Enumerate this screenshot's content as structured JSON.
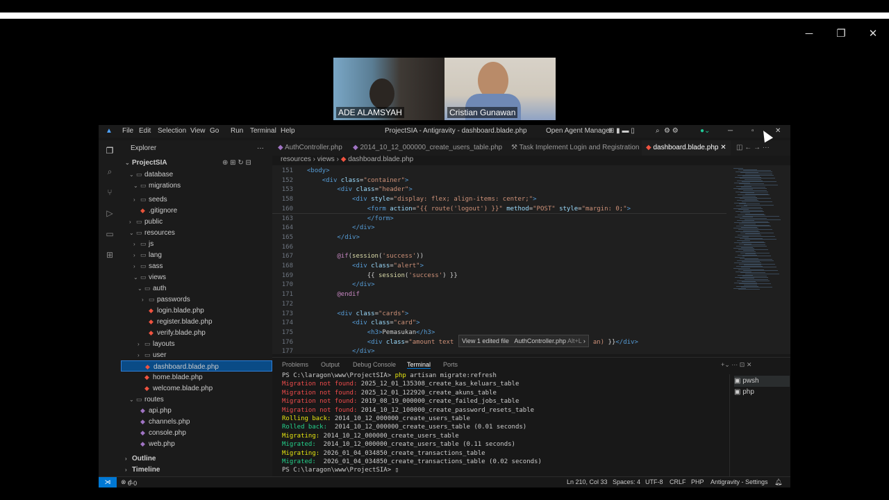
{
  "video_tiles": [
    {
      "name": "ADE ALAMSYAH"
    },
    {
      "name": "Cristian Gunawan"
    }
  ],
  "vscode": {
    "menu": [
      "File",
      "Edit",
      "Selection",
      "View",
      "Go",
      "Run",
      "Terminal",
      "Help"
    ],
    "window_title": "ProjectSIA - Antigravity - dashboard.blade.php",
    "agent_manager": "Open Agent Manager",
    "explorer": {
      "title": "Explorer",
      "project": "ProjectSIA",
      "tree": [
        {
          "label": "database",
          "depth": 1,
          "chev": "⌄",
          "kind": "folder"
        },
        {
          "label": "migrations",
          "depth": 2,
          "chev": "⌄",
          "kind": "folder"
        },
        {
          "label": "seeds",
          "depth": 2,
          "chev": "›",
          "kind": "folder"
        },
        {
          "label": ".gitignore",
          "depth": 2,
          "chev": "",
          "kind": "git"
        },
        {
          "label": "public",
          "depth": 1,
          "chev": "›",
          "kind": "folder"
        },
        {
          "label": "resources",
          "depth": 1,
          "chev": "⌄",
          "kind": "folder"
        },
        {
          "label": "js",
          "depth": 2,
          "chev": "›",
          "kind": "folder"
        },
        {
          "label": "lang",
          "depth": 2,
          "chev": "›",
          "kind": "folder"
        },
        {
          "label": "sass",
          "depth": 2,
          "chev": "›",
          "kind": "folder"
        },
        {
          "label": "views",
          "depth": 2,
          "chev": "⌄",
          "kind": "folder"
        },
        {
          "label": "auth",
          "depth": 3,
          "chev": "⌄",
          "kind": "folder"
        },
        {
          "label": "passwords",
          "depth": 4,
          "chev": "›",
          "kind": "folder"
        },
        {
          "label": "login.blade.php",
          "depth": 4,
          "chev": "",
          "kind": "blade"
        },
        {
          "label": "register.blade.php",
          "depth": 4,
          "chev": "",
          "kind": "blade"
        },
        {
          "label": "verify.blade.php",
          "depth": 4,
          "chev": "",
          "kind": "blade"
        },
        {
          "label": "layouts",
          "depth": 3,
          "chev": "›",
          "kind": "folder"
        },
        {
          "label": "user",
          "depth": 3,
          "chev": "›",
          "kind": "folder"
        },
        {
          "label": "dashboard.blade.php",
          "depth": 3,
          "chev": "",
          "kind": "blade",
          "selected": true
        },
        {
          "label": "home.blade.php",
          "depth": 3,
          "chev": "",
          "kind": "blade"
        },
        {
          "label": "welcome.blade.php",
          "depth": 3,
          "chev": "",
          "kind": "blade"
        },
        {
          "label": "routes",
          "depth": 1,
          "chev": "⌄",
          "kind": "folder"
        },
        {
          "label": "api.php",
          "depth": 2,
          "chev": "",
          "kind": "php"
        },
        {
          "label": "channels.php",
          "depth": 2,
          "chev": "",
          "kind": "php"
        },
        {
          "label": "console.php",
          "depth": 2,
          "chev": "",
          "kind": "php"
        },
        {
          "label": "web.php",
          "depth": 2,
          "chev": "",
          "kind": "php"
        }
      ],
      "outline": "Outline",
      "timeline": "Timeline"
    },
    "tabs": [
      {
        "label": "AuthController.php",
        "active": false
      },
      {
        "label": "2014_10_12_000000_create_users_table.php",
        "active": false
      },
      {
        "label": "Task  Implement Login and Registration",
        "active": false
      },
      {
        "label": "dashboard.blade.php",
        "active": true
      }
    ],
    "breadcrumb": [
      "resources",
      "views",
      "dashboard.blade.php"
    ],
    "code_lines": [
      {
        "n": "151",
        "html": "<span class='tg'>&lt;body&gt;</span>"
      },
      {
        "n": "152",
        "html": "    <span class='tg'>&lt;div</span> <span class='at'>class</span>=<span class='st'>\"container\"</span><span class='tg'>&gt;</span>"
      },
      {
        "n": "153",
        "html": "        <span class='tg'>&lt;div</span> <span class='at'>class</span>=<span class='st'>\"header\"</span><span class='tg'>&gt;</span>"
      },
      {
        "n": "158",
        "html": "            <span class='tg'>&lt;div</span> <span class='at'>style</span>=<span class='st'>\"display: flex; align-items: center;\"</span><span class='tg'>&gt;</span>"
      },
      {
        "n": "160",
        "html": "                <span class='tg'>&lt;form</span> <span class='at'>action</span>=<span class='st'>\"{{ route('logout') }}\"</span> <span class='at'>method</span>=<span class='st'>\"POST\"</span> <span class='at'>style</span>=<span class='st'>\"margin: 0;\"</span><span class='tg'>&gt;</span>"
      },
      {
        "n": "163",
        "html": "                <span class='tg'>&lt;/form&gt;</span>"
      },
      {
        "n": "164",
        "html": "            <span class='tg'>&lt;/div&gt;</span>"
      },
      {
        "n": "165",
        "html": "        <span class='tg'>&lt;/div&gt;</span>"
      },
      {
        "n": "166",
        "html": ""
      },
      {
        "n": "167",
        "html": "        <span class='kw'>@if</span>(<span class='fn'>session</span>(<span class='st'>'success'</span>))"
      },
      {
        "n": "168",
        "html": "            <span class='tg'>&lt;div</span> <span class='at'>class</span>=<span class='st'>\"alert\"</span><span class='tg'>&gt;</span>"
      },
      {
        "n": "169",
        "html": "                {{ <span class='fn'>session</span>(<span class='st'>'success'</span>) }}"
      },
      {
        "n": "170",
        "html": "            <span class='tg'>&lt;/div&gt;</span>"
      },
      {
        "n": "171",
        "html": "        <span class='kw'>@endif</span>"
      },
      {
        "n": "172",
        "html": ""
      },
      {
        "n": "173",
        "html": "        <span class='tg'>&lt;div</span> <span class='at'>class</span>=<span class='st'>\"cards\"</span><span class='tg'>&gt;</span>"
      },
      {
        "n": "174",
        "html": "            <span class='tg'>&lt;div</span> <span class='at'>class</span>=<span class='st'>\"card\"</span><span class='tg'>&gt;</span>"
      },
      {
        "n": "175",
        "html": "                <span class='tg'>&lt;h3&gt;</span>Pemasukan<span class='tg'>&lt;/h3&gt;</span>"
      },
      {
        "n": "176",
        "html": "                <span class='tg'>&lt;div</span> <span class='at'>class</span>=<span class='st'>\"amount text</span>                                     <span class='st'>an)</span> }}<span class='tg'>&lt;/div&gt;</span>"
      },
      {
        "n": "177",
        "html": "            <span class='tg'>&lt;/div&gt;</span>"
      }
    ],
    "hint": {
      "view_edited": "View 1 edited file",
      "file": "AuthController.php",
      "shortcut": "Alt+L"
    },
    "panel_tabs": [
      "Problems",
      "Output",
      "Debug Console",
      "Terminal",
      "Ports"
    ],
    "panel_active": "Terminal",
    "terminal_lines": [
      {
        "parts": [
          {
            "c": "",
            "t": "PS C:\\laragon\\www\\ProjectSIA> "
          },
          {
            "c": "t-yel",
            "t": "php"
          },
          {
            "c": "",
            "t": " artisan migrate:refresh"
          }
        ]
      },
      {
        "parts": [
          {
            "c": "t-red",
            "t": "Migration not found: "
          },
          {
            "c": "",
            "t": "2025_12_01_135308_create_kas_keluars_table"
          }
        ]
      },
      {
        "parts": [
          {
            "c": "t-red",
            "t": "Migration not found: "
          },
          {
            "c": "",
            "t": "2025_12_01_122920_create_akuns_table"
          }
        ]
      },
      {
        "parts": [
          {
            "c": "t-red",
            "t": "Migration not found: "
          },
          {
            "c": "",
            "t": "2019_08_19_000000_create_failed_jobs_table"
          }
        ]
      },
      {
        "parts": [
          {
            "c": "t-red",
            "t": "Migration not found: "
          },
          {
            "c": "",
            "t": "2014_10_12_100000_create_password_resets_table"
          }
        ]
      },
      {
        "parts": [
          {
            "c": "t-yel",
            "t": "Rolling back: "
          },
          {
            "c": "",
            "t": "2014_10_12_000000_create_users_table"
          }
        ]
      },
      {
        "parts": [
          {
            "c": "t-grn",
            "t": "Rolled back:  "
          },
          {
            "c": "",
            "t": "2014_10_12_000000_create_users_table (0.01 seconds)"
          }
        ]
      },
      {
        "parts": [
          {
            "c": "t-yel",
            "t": "Migrating: "
          },
          {
            "c": "",
            "t": "2014_10_12_000000_create_users_table"
          }
        ]
      },
      {
        "parts": [
          {
            "c": "t-grn",
            "t": "Migrated:  "
          },
          {
            "c": "",
            "t": "2014_10_12_000000_create_users_table (0.11 seconds)"
          }
        ]
      },
      {
        "parts": [
          {
            "c": "t-yel",
            "t": "Migrating: "
          },
          {
            "c": "",
            "t": "2026_01_04_034850_create_transactions_table"
          }
        ]
      },
      {
        "parts": [
          {
            "c": "t-grn",
            "t": "Migrated:  "
          },
          {
            "c": "",
            "t": "2026_01_04_034850_create_transactions_table (0.02 seconds)"
          }
        ]
      },
      {
        "parts": [
          {
            "c": "",
            "t": "PS C:\\laragon\\www\\ProjectSIA> "
          }
        ]
      }
    ],
    "terminal_sessions": [
      "pwsh",
      "php"
    ],
    "status": {
      "errors": "0",
      "warnings": "0",
      "position": "Ln 210, Col 33",
      "spaces": "Spaces: 4",
      "encoding": "UTF-8",
      "eol": "CRLF",
      "lang": "PHP",
      "settings": "Antigravity - Settings"
    },
    "colors": {
      "accent": "#0078d4",
      "selection": "#0a4b86",
      "blade": "#f05340",
      "php": "#a074c4"
    }
  }
}
